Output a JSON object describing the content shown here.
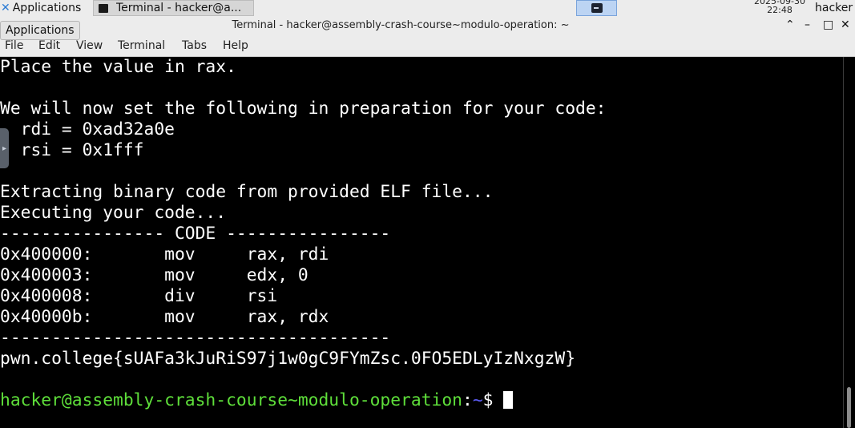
{
  "panel": {
    "applications_label": "Applications",
    "task_label": "Terminal - hacker@a...",
    "clock_date": "2025-09-30",
    "clock_time": "22:48",
    "user": "hacker"
  },
  "window": {
    "title": "Terminal - hacker@assembly-crash-course~modulo-operation: ~",
    "controls": {
      "shade": "⌃",
      "minimize": "–",
      "maximize": "□",
      "close": "✕"
    }
  },
  "menubar": [
    "File",
    "Edit",
    "View",
    "Terminal",
    "Tabs",
    "Help"
  ],
  "tooltip": "Applications",
  "terminal": {
    "lines": [
      "Place the value in rax.",
      "",
      "We will now set the following in preparation for your code:",
      "  rdi = 0xad32a0e",
      "  rsi = 0x1fff",
      "",
      "Extracting binary code from provided ELF file...",
      "Executing your code...",
      "---------------- CODE ----------------",
      "0x400000:       mov     rax, rdi",
      "0x400003:       mov     edx, 0",
      "0x400008:       div     rsi",
      "0x40000b:       mov     rax, rdx",
      "--------------------------------------",
      "pwn.college{sUAFa3kJuRiS97j1w0gC9FYmZsc.0FO5EDLyIzNxgzW}",
      ""
    ],
    "prompt": {
      "user_host": "hacker@assembly-crash-course~modulo-operation",
      "colon": ":",
      "path": "~",
      "symbol": "$ "
    }
  },
  "colors": {
    "prompt_user": "#5ede3a",
    "prompt_path": "#5a5af0",
    "terminal_bg": "#000000",
    "terminal_fg": "#ffffff"
  }
}
